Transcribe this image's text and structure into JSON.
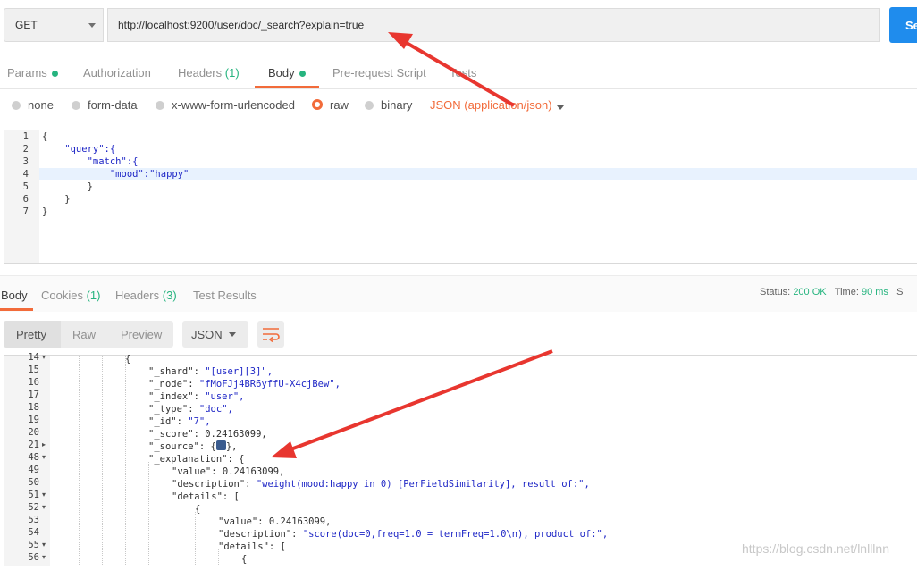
{
  "request": {
    "method": "GET",
    "url": "http://localhost:9200/user/doc/_search?explain=true",
    "send_label": "Se"
  },
  "request_tabs": [
    {
      "label": "Params",
      "dot": true
    },
    {
      "label": "Authorization"
    },
    {
      "label": "Headers",
      "count": "(1)"
    },
    {
      "label": "Body",
      "dot": true,
      "active": true
    },
    {
      "label": "Pre-request Script"
    },
    {
      "label": "Tests"
    }
  ],
  "body_types": [
    "none",
    "form-data",
    "x-www-form-urlencoded",
    "raw",
    "binary"
  ],
  "body_type_selected": "raw",
  "content_type": "JSON (application/json)",
  "request_editor": {
    "line_numbers": [
      "1",
      "2",
      "3",
      "4",
      "5",
      "6",
      "7"
    ],
    "lines": [
      "{",
      "    \"query\":{",
      "        \"match\":{",
      "            \"mood\":\"happy\"",
      "        }",
      "    }",
      "}"
    ],
    "active_line": "4"
  },
  "response_tabs": [
    {
      "label": "Body",
      "active": true
    },
    {
      "label": "Cookies",
      "count": "(1)"
    },
    {
      "label": "Headers",
      "count": "(3)"
    },
    {
      "label": "Test Results"
    }
  ],
  "status": {
    "label": "Status:",
    "value": "200 OK",
    "time_label": "Time:",
    "time_value": "90 ms",
    "size_label": "S"
  },
  "view_modes": [
    "Pretty",
    "Raw",
    "Preview"
  ],
  "format": "JSON",
  "response_lines": [
    {
      "n": "14",
      "k": "",
      "text": "{"
    },
    {
      "n": "15",
      "k": "\"_shard\": ",
      "v": "\"[user][3]\","
    },
    {
      "n": "16",
      "k": "\"_node\": ",
      "v": "\"fMoFJj4BR6yffU-X4cjBew\","
    },
    {
      "n": "17",
      "k": "\"_index\": ",
      "v": "\"user\","
    },
    {
      "n": "18",
      "k": "\"_type\": ",
      "v": "\"doc\","
    },
    {
      "n": "19",
      "k": "\"_id\": ",
      "v": "\"7\","
    },
    {
      "n": "20",
      "k": "\"_score\": ",
      "v": "0.24163099,"
    },
    {
      "n": "21",
      "k": "\"_source\": {",
      "v": "},"
    },
    {
      "n": "48",
      "k": "\"_explanation\": {",
      "v": ""
    },
    {
      "n": "49",
      "k": "\"value\": ",
      "v": "0.24163099,"
    },
    {
      "n": "50",
      "k": "\"description\": ",
      "v": "\"weight(mood:happy in 0) [PerFieldSimilarity], result of:\","
    },
    {
      "n": "51",
      "k": "\"details\": [",
      "v": ""
    },
    {
      "n": "52",
      "k": "{",
      "v": ""
    },
    {
      "n": "53",
      "k": "\"value\": ",
      "v": "0.24163099,"
    },
    {
      "n": "54",
      "k": "\"description\": ",
      "v": "\"score(doc=0,freq=1.0 = termFreq=1.0\\n), product of:\","
    },
    {
      "n": "55",
      "k": "\"details\": [",
      "v": ""
    },
    {
      "n": "56",
      "k": "{",
      "v": ""
    }
  ],
  "watermark": "https://blog.csdn.net/lnlllnn",
  "colors": {
    "accent": "#f26b3a",
    "send": "#1f8ced",
    "ok": "#26b47f",
    "arrow": "#e8362f"
  }
}
